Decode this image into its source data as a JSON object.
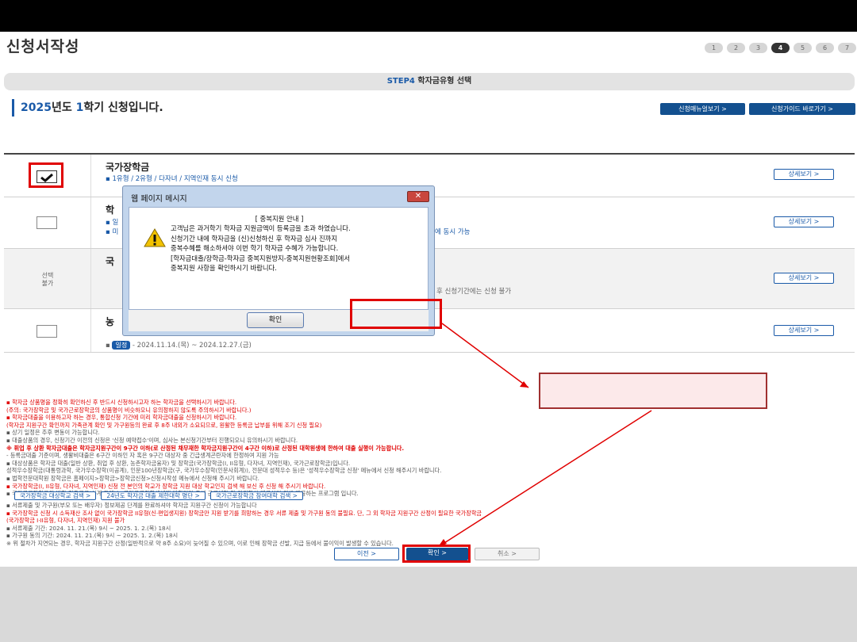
{
  "header": {
    "title": "신청서작성",
    "steps": [
      "1",
      "2",
      "3",
      "4",
      "5",
      "6",
      "7"
    ],
    "active_step": "4"
  },
  "stepbar": {
    "step": "STEP4",
    "label": "학자금유형 선택"
  },
  "semester": {
    "year": "2025",
    "mid": "년도 ",
    "term": "1",
    "tail": "학기 신청입니다."
  },
  "buttons": {
    "manual": "신청매뉴얼보기 >",
    "guide": "신청가이드 바로가기 >",
    "detail": "상세보기 >"
  },
  "rows": [
    {
      "title": "국가장학금",
      "sub": "▪ 1유형 / 2유형 / 다자녀 / 지역인재 동시 신청"
    },
    {
      "title": "학",
      "sub": "▪ 일",
      "sub2": "▪ 미",
      "tail": "에 동시 가능"
    },
    {
      "title": "국",
      "status": "선택\n불가",
      "tail": "후 신청기간에는 신청 불가"
    },
    {
      "title": "농",
      "badge": "일정",
      "dates": "- 2024.11.14.(목) ~ 2024.12.27.(금)"
    }
  ],
  "dialog": {
    "title": "웹 페이지 메시지",
    "close": "✕",
    "heading": "[ 중복지원 안내 ]",
    "body": "고객님은 과거학기 학자금 지원금액이 등록금을 초과 하였습니다.\n신청기간 내에 학자금을 (신)신청하신 후 학자금 심사 진까지\n중복수혜를 해소하셔야 이번 학기 학자금 수혜가 가능합니다.\n[학자금대출/장학금-학자금 중복지원방지-중복지원현황조회]에서\n중복지원 사항을 확인하시기 바랍니다.",
    "ok": "확인"
  },
  "notes": [
    "▪ 학자금 상품명을 정확히 확인하신 후 반드시 신청하시고자 하는 학자금을 선택하시기 바랍니다.",
    "  (주의: 국가장학금 및 국가근로장학금의 상품명이 비슷하오니 유의정하지 않도록 주의하시기 바랍니다.)",
    "▪ 학자금대출을 이용하고자 하는 경우, 통합신청 기간에 미리 학자금대출을 신청하시기 바랍니다.",
    "  (학자금 지원구간 확인까지 가족관계 확인 및 가구원등의 완료 후 8주 내외가 소요되므로, 원활한 등록금 납부를 위해 조기 신청 필요)",
    "▪ 상기 일정은 추후 변동이 가능합니다.",
    "▪ 대출상품의 경우, 신청기간 이전의 신청은 '신청 예약접수'이며, 심사는 본신청기간부터 진행되오니 유의하시기 바랍니다.",
    "※ 휘업 후 상환 학자금대출은 학자금지원구간이 9구간 이하(로 산정된 채무재한 학자금지원구간이 4구간 이하)로 산정된 대학원생에 한하여 대출 실행이 가능합니다.",
    "  - 등록금대출 기준이며, 생활비대출은 6구간 이하인 자 혹은 9구간 대상자 중 긴급생계곤란자에 한정하여 지원 가능",
    "▪ 대상상품은 학자금 대출(일반 상환, 취업 후 상환, 농촌학자금융자) 및 장학금(국가장학금(I, II유형, 다자녀, 지역인재), 국가근로장학금)입니다.",
    "  성적우수장학금(대통령과학, 국가우수장학(이공계), 인문100년장학금(구, 국가우수장학(인문사회계)), 전문대 성적우수 등)은 '성적우수장학금 신청' 메뉴에서 신청 해주시기 바랍니다.",
    "▪ 법학전문대학원 장학금은 홈페이지>장학금>장학금신청>신청시작성 메뉴에서 신청해 주시기 바랍니다.",
    "▪ 국가장학금(I, II유형, 다자녀, 지역인재) 신청 전 본인의 학교가 장학금 지원 대상 학교인지 검색 해 보신 후 신청 해 주시기 바랍니다.",
    "▪ 국가근로장학금의 방학 집중근로(하계·동계)는 국가근로장학생에게 방학기간 중에 근로체험 및 자격향상 제공하기 위해 제공하는 프로그램 입니다."
  ],
  "links": [
    "국가장학금 대상학교 검색 >",
    "24년도 학자금 대출 제한대학 명단 >",
    "국가근로장학금 참여대학 검색 >"
  ],
  "notes2": [
    "▪ 서류제출 및 가구원(부모 또는 배우자) 정보제공 단계를 완료하셔야 학자금 지원구간 신청이 가능합니다",
    "▪ 국가장학금 신청 시 소득재산 조사 없이 국가장학금 II유형(신·편입생지원) 장학금만 지원 받기를 희망하는 경우 서류 제출 및 가구원 동의 불필요. 단, 그 외 학자금 지원구간 산정이 필요한 국가장학금",
    "  (국가장학금 I·II유형, 다자녀, 지역인재) 지원 불가",
    "▪ 서류제출 기간: 2024. 11. 21.(목) 9시 ~ 2025. 1. 2.(목) 18시",
    "▪ 가구원 동의 기간: 2024. 11. 21.(목) 9시 ~ 2025. 1. 2.(목) 18시",
    "  ※ 위 절차가 지연되는 경우, 학자금 지원구간 산정(일반적으로 약 8주 소요)이 늦어질 수 있으며, 이로 인해 장학금 선발, 지급 등에서 불이익이 발생할 수 있습니다."
  ],
  "bottom_buttons": {
    "prev": "이전   >",
    "confirm": "확인   >",
    "cancel": "취소   >"
  }
}
